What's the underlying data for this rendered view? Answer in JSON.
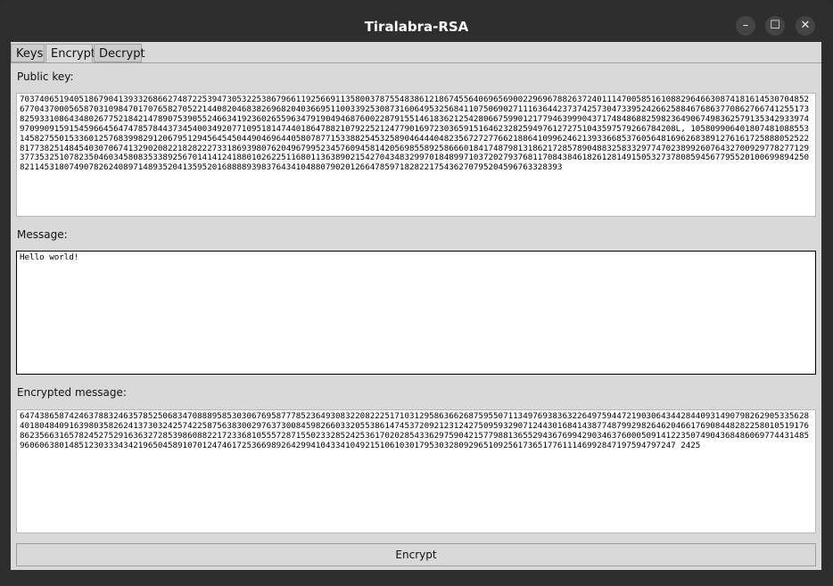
{
  "window": {
    "title": "Tiralabra-RSA",
    "minimize_glyph": "–",
    "maximize_glyph": "☐",
    "close_glyph": "✕"
  },
  "tabs": [
    "Keys",
    "Encrypt",
    "Decrypt"
  ],
  "active_tab": "Encrypt",
  "encrypt": {
    "public_key_label": "Public key:",
    "public_key_value": "7037406519405186790413933268662748722539473053225386796611925669113580037875548386121867455640696569002296967882637240111470058516108829646630874181614530704852677043700056587031098470170765827052214408204683826968204036695110033925308731606495325684110750690271116364423737425730473395242662588467686377086276674125517382593310864348026775218421478907539055246634192360265596347919049468760022879155146183621254280667599012177946399904371748486882598236490674983625791353429339749709909159154596645647478578443734540034920771095181474401864788210792252124779016972303659151646232825949761272751043597579266784208L, 10580990640180748108855314582755015336012576839982912067951294564545044904696440580787715338825453258904644404823567272776621886410996246213933668537605648169626838912761617258880525228177382514845403070674132902082218282227331869398076204967995234576094581420569855892586660184174879813186217285789048832583329774702389926076432700929778277129377353251078235046034580835338925670141412418801026225116801136389021542704348329970184899710372027937681170843846182612814915053273780859456779552010069989425082114531807490782624089714893520413595201688889398376434104880790201266478597182822175436270795204596763328393\n",
    "message_label": "Message:",
    "message_value": "Hello world!",
    "encrypted_label": "Encrypted message:",
    "encrypted_value": "6474386587424637883246357852506834708889585303067695877785236493083220822251710312958636626875955071134976938363226497594472190306434428440931490798262905335628401804840916398035826241373032425742258756383002976373008459826603320553861474537209212312427509593290712443016841438774879929826462046617690844828225801051917686235663165782452752916363272853986088221723368105557287155023328524253617020285433629759042157798813655294367699429034637600050914122350749043684860697744314859606063801485123033343421965045891070124746172536698926429941043341049215106103017953032809296510925617365177611146992847197594797247 2425"
  },
  "encrypt_button_label": "Encrypt"
}
